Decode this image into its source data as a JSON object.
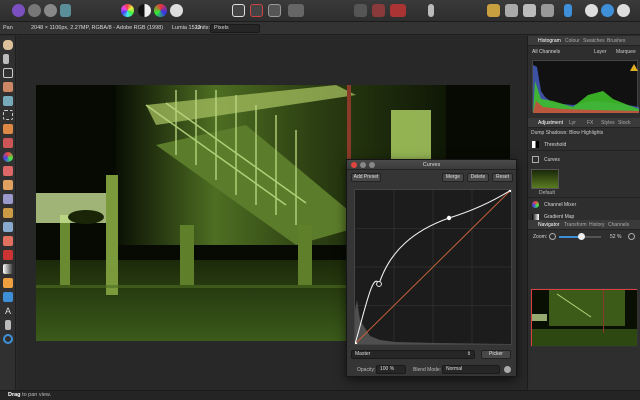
{
  "context_bar": {
    "tool": "Pan",
    "doc_info": "2048 × 1106px, 2.27MP, RGBA/8 - Adobe RGB (1998)",
    "camera": "Lumia 1520",
    "units_label": "Units:",
    "units_value": "Pixels"
  },
  "panels": {
    "top_tabs": [
      "Histogram",
      "Colour",
      "Swatches",
      "Brushes"
    ],
    "histogram": {
      "channel": "All Channels",
      "options": [
        "Layer",
        "Marquee"
      ]
    },
    "adjustment_tabs": [
      "Adjustment",
      "Lyr",
      "FX",
      "Styles",
      "Stock"
    ],
    "adjustment_hint": "Dump Shadows: Blow Highlights",
    "adjustments": [
      {
        "label": "Threshold",
        "icon": "threshold-icon"
      },
      {
        "label": "Curves",
        "icon": "curves-icon"
      },
      {
        "label": "Default",
        "icon": "preset-thumbnail"
      },
      {
        "label": "Channel Mixer",
        "icon": "channel-mixer-icon"
      },
      {
        "label": "Gradient Map",
        "icon": "gradient-map-icon"
      }
    ],
    "navigator_tabs": [
      "Navigator",
      "Transform",
      "History",
      "Channels"
    ],
    "navigator": {
      "zoom_label": "Zoom:",
      "zoom_value": "52 %",
      "zoom_fraction": 0.52
    }
  },
  "curves_dialog": {
    "title": "Curves",
    "add_preset": "Add Preset",
    "merge": "Merge",
    "delete": "Delete",
    "reset": "Reset",
    "channel": "Master",
    "picker": "Picker",
    "opacity_label": "Opacity:",
    "opacity_value": "100 %",
    "blend_label": "Blend Mode:",
    "blend_value": "Normal"
  },
  "status": {
    "action": "Drag",
    "message": "to pan view."
  },
  "colors": {
    "accent": "#3f8fd8",
    "curve_diagonal": "#c4623a",
    "histogram_green": "#3fbf2a",
    "histogram_blue": "#4a63c9"
  }
}
